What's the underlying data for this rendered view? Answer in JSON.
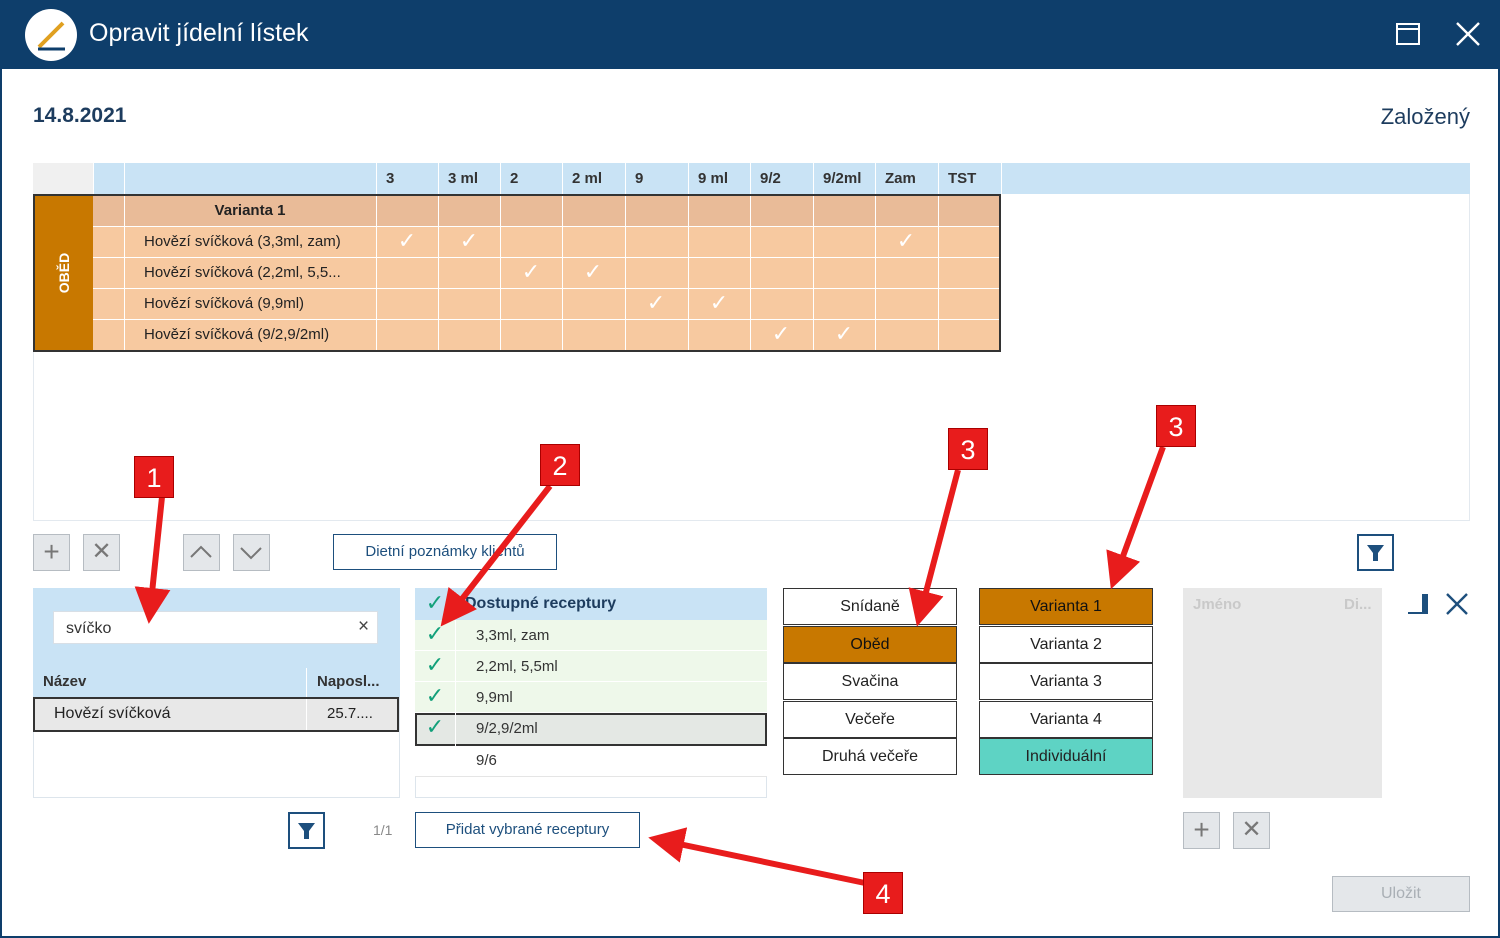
{
  "window": {
    "title": "Opravit jídelní lístek",
    "maximize_icon": "maximize-icon",
    "close_icon": "close-icon"
  },
  "header": {
    "date": "14.8.2021",
    "status": "Založený"
  },
  "grid": {
    "columns": [
      "3",
      "3 ml",
      "2",
      "2 ml",
      "9",
      "9 ml",
      "9/2",
      "9/2ml",
      "Zam",
      "TST"
    ],
    "meal": "OBĚD",
    "variant": "Varianta 1",
    "rows": [
      {
        "name": "Hovězí svíčková (3,3ml, zam)",
        "checks": [
          true,
          true,
          false,
          false,
          false,
          false,
          false,
          false,
          true,
          false
        ]
      },
      {
        "name": "Hovězí svíčková (2,2ml, 5,5...",
        "checks": [
          false,
          false,
          true,
          true,
          false,
          false,
          false,
          false,
          false,
          false
        ]
      },
      {
        "name": "Hovězí svíčková (9,9ml)",
        "checks": [
          false,
          false,
          false,
          false,
          true,
          true,
          false,
          false,
          false,
          false
        ]
      },
      {
        "name": "Hovězí svíčková (9/2,9/2ml)",
        "checks": [
          false,
          false,
          false,
          false,
          false,
          false,
          true,
          true,
          false,
          false
        ]
      }
    ]
  },
  "toolbar": {
    "diet_notes_label": "Dietní poznámky klientů"
  },
  "search": {
    "value": "svíčko",
    "clear_symbol": "×",
    "col_name": "Název",
    "col_last": "Naposl...",
    "result_name": "Hovězí svíčková",
    "result_date": "25.7....",
    "page_info": "1/1"
  },
  "recipes": {
    "header": "Dostupné receptury",
    "items": [
      {
        "label": "3,3ml, zam",
        "checked": true
      },
      {
        "label": "2,2ml, 5,5ml",
        "checked": true
      },
      {
        "label": "9,9ml",
        "checked": true
      },
      {
        "label": "9/2,9/2ml",
        "checked": true
      },
      {
        "label": "9/6",
        "checked": false
      }
    ],
    "add_label": "Přidat vybrané receptury"
  },
  "meals": {
    "items": [
      "Snídaně",
      "Oběd",
      "Svačina",
      "Večeře",
      "Druhá večeře"
    ],
    "active_index": 1
  },
  "variants": {
    "items": [
      "Varianta 1",
      "Varianta 2",
      "Varianta 3",
      "Varianta 4",
      "Individuální"
    ],
    "active_index": 0
  },
  "persons": {
    "col_name": "Jméno",
    "col_diet": "Di..."
  },
  "footer": {
    "save_label": "Uložit"
  },
  "annotations": [
    "1",
    "2",
    "3",
    "3",
    "4"
  ],
  "colors": {
    "titlebar": "#0e3e6b",
    "meal_orange": "#c87800",
    "cell_peach": "#f7c9a0",
    "header_blue": "#c9e3f5",
    "check_green": "#12a07a",
    "individual_teal": "#5ed3c4",
    "annotation_red": "#e81c1c"
  }
}
